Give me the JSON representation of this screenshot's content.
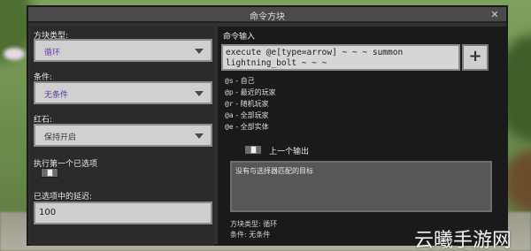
{
  "dialog": {
    "title": "命令方块",
    "close_glyph": "✕"
  },
  "left": {
    "block_type_label": "方块类型:",
    "block_type_value": "循环",
    "condition_label": "条件:",
    "condition_value": "无条件",
    "redstone_label": "红石:",
    "redstone_value": "保持开启",
    "execute_first_label": "执行第一个已选项",
    "delay_label": "已选项中的延迟:",
    "delay_value": "100"
  },
  "right": {
    "command_input_label": "命令输入",
    "command_line1": "execute @e[type=arrow] ~ ~ ~ summon",
    "command_line2": "lightning_bolt ~ ~ ~",
    "plus_glyph": "+",
    "help": [
      {
        "code": "@s",
        "text": "- 自己"
      },
      {
        "code": "@p",
        "text": "- 最近的玩家"
      },
      {
        "code": "@r",
        "text": "- 随机玩家"
      },
      {
        "code": "@a",
        "text": "- 全部玩家"
      },
      {
        "code": "@e",
        "text": "- 全部实体"
      }
    ],
    "previous_output_label": "上一个输出",
    "output_text": "没有与选择器匹配的目标",
    "footer_block_type": "方块类型: 循环",
    "footer_condition": "条件: 无条件"
  },
  "watermark": "云曦手游网",
  "colors": {
    "purple_value": "#6a3fb8",
    "panel_dark": "#1a1a1a"
  }
}
